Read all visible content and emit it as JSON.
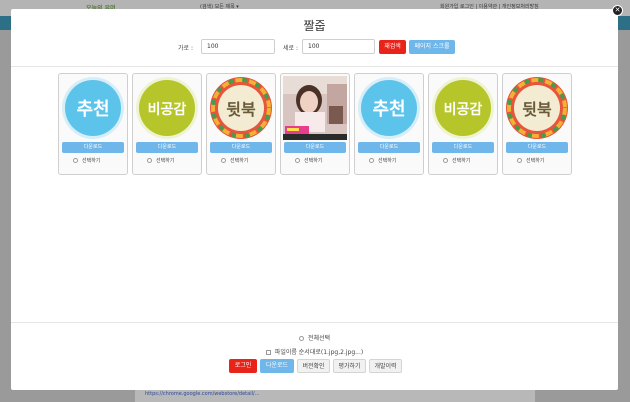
{
  "background": {
    "logo": "오늘의 유머",
    "search_text": "(검색) 모든 제목 ▾",
    "right_links": "회원가입 로그인 | 이용약관 | 개인정보처리방침",
    "url_text": "https://chrome.google.com/webstore/detail/..."
  },
  "modal": {
    "title": "짤줍",
    "close_label": "✕",
    "width_label": "가로 :",
    "width_value": "100",
    "height_label": "세로 :",
    "height_value": "100",
    "research_button": "재검색",
    "page_scroll_button": "페이지 스크롤",
    "cards": [
      {
        "type": "badge",
        "text": "추천",
        "download": "다운로드",
        "select": "선택하기"
      },
      {
        "type": "badge",
        "text": "비공감",
        "download": "다운로드",
        "select": "선택하기"
      },
      {
        "type": "badge",
        "text": "뒷북",
        "download": "다운로드",
        "select": "선택하기"
      },
      {
        "type": "photo",
        "text": "",
        "download": "다운로드",
        "select": "선택하기"
      },
      {
        "type": "badge",
        "text": "추천",
        "download": "다운로드",
        "select": "선택하기"
      },
      {
        "type": "badge",
        "text": "비공감",
        "download": "다운로드",
        "select": "선택하기"
      },
      {
        "type": "badge",
        "text": "뒷북",
        "download": "다운로드",
        "select": "선택하기"
      }
    ],
    "select_all": "전체선택",
    "filename_order": "파일이름 순서대로(1.jpg,2.jpg...)",
    "footer": {
      "login": "로그인",
      "download": "다운로드",
      "version_check": "버전확인",
      "rate": "평가하기",
      "changelog": "개발이력"
    }
  },
  "colors": {
    "primary_blue": "#6fb6ea",
    "accent_red": "#e8241a",
    "recommend_blue": "#5cc4ea",
    "dislike_green": "#b5c52a"
  }
}
